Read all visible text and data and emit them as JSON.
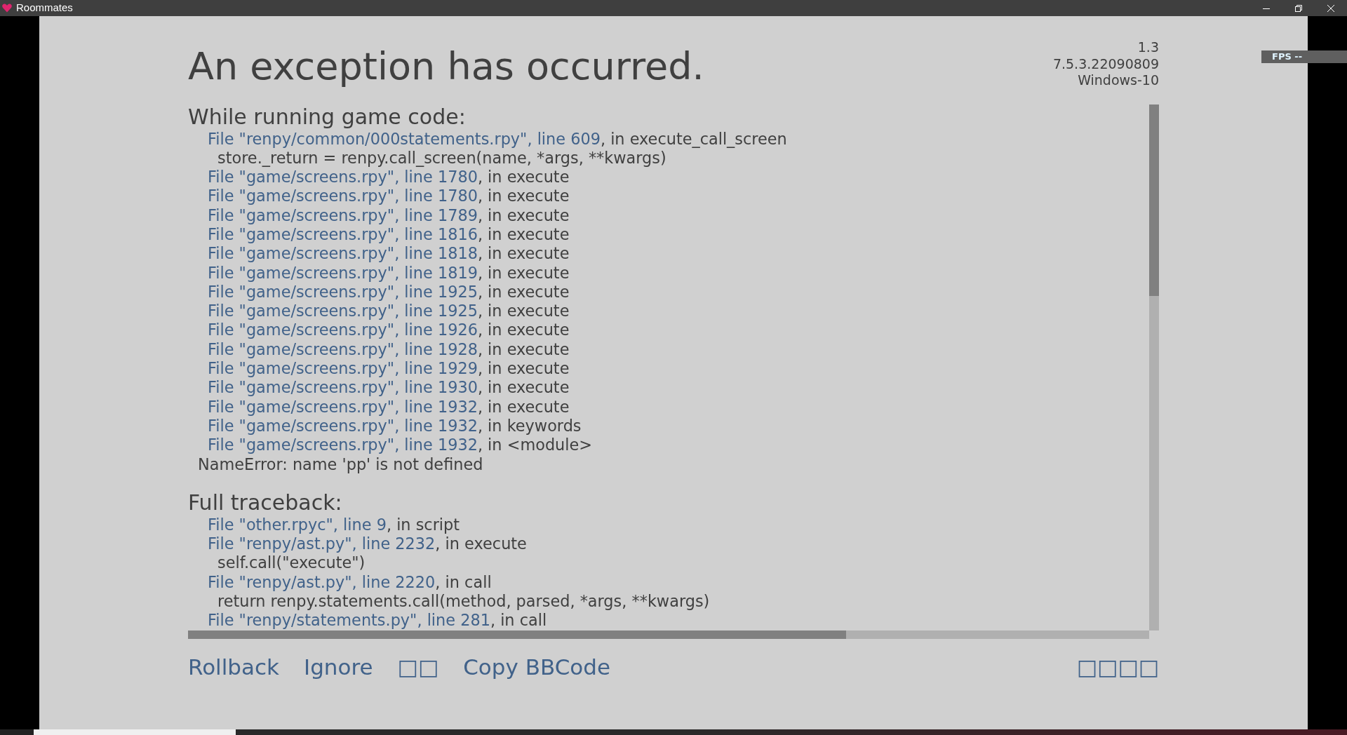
{
  "window": {
    "title": "Roommates"
  },
  "header": {
    "title": "An exception has occurred.",
    "version_info": [
      "1.3",
      "7.5.3.22090809",
      "Windows-10"
    ]
  },
  "fps_overlay": "FPS --",
  "sections": [
    {
      "heading": "While running game code:",
      "lines": [
        {
          "kind": "frame",
          "link": "File \"renpy/common/000statements.rpy\", line 609",
          "rest": ", in execute_call_screen"
        },
        {
          "kind": "code",
          "text": "store._return = renpy.call_screen(name, *args, **kwargs)"
        },
        {
          "kind": "frame",
          "link": "File \"game/screens.rpy\", line 1780",
          "rest": ", in execute"
        },
        {
          "kind": "frame",
          "link": "File \"game/screens.rpy\", line 1780",
          "rest": ", in execute"
        },
        {
          "kind": "frame",
          "link": "File \"game/screens.rpy\", line 1789",
          "rest": ", in execute"
        },
        {
          "kind": "frame",
          "link": "File \"game/screens.rpy\", line 1816",
          "rest": ", in execute"
        },
        {
          "kind": "frame",
          "link": "File \"game/screens.rpy\", line 1818",
          "rest": ", in execute"
        },
        {
          "kind": "frame",
          "link": "File \"game/screens.rpy\", line 1819",
          "rest": ", in execute"
        },
        {
          "kind": "frame",
          "link": "File \"game/screens.rpy\", line 1925",
          "rest": ", in execute"
        },
        {
          "kind": "frame",
          "link": "File \"game/screens.rpy\", line 1925",
          "rest": ", in execute"
        },
        {
          "kind": "frame",
          "link": "File \"game/screens.rpy\", line 1926",
          "rest": ", in execute"
        },
        {
          "kind": "frame",
          "link": "File \"game/screens.rpy\", line 1928",
          "rest": ", in execute"
        },
        {
          "kind": "frame",
          "link": "File \"game/screens.rpy\", line 1929",
          "rest": ", in execute"
        },
        {
          "kind": "frame",
          "link": "File \"game/screens.rpy\", line 1930",
          "rest": ", in execute"
        },
        {
          "kind": "frame",
          "link": "File \"game/screens.rpy\", line 1932",
          "rest": ", in execute"
        },
        {
          "kind": "frame",
          "link": "File \"game/screens.rpy\", line 1932",
          "rest": ", in keywords"
        },
        {
          "kind": "frame",
          "link": "File \"game/screens.rpy\", line 1932",
          "rest": ", in <module>"
        },
        {
          "kind": "error",
          "text": "NameError: name 'pp' is not defined"
        }
      ]
    },
    {
      "heading": "Full traceback:",
      "lines": [
        {
          "kind": "frame",
          "link": "File \"other.rpyc\", line 9",
          "rest": ", in script"
        },
        {
          "kind": "frame",
          "link": "File \"renpy/ast.py\", line 2232",
          "rest": ", in execute"
        },
        {
          "kind": "code",
          "text": "self.call(\"execute\")"
        },
        {
          "kind": "frame",
          "link": "File \"renpy/ast.py\", line 2220",
          "rest": ", in call"
        },
        {
          "kind": "code",
          "text": "return renpy.statements.call(method, parsed, *args, **kwargs)"
        },
        {
          "kind": "frame",
          "link": "File \"renpy/statements.py\", line 281",
          "rest": ", in call"
        }
      ]
    }
  ],
  "actions": [
    "Rollback",
    "Ignore",
    "□□",
    "Copy BBCode"
  ],
  "right_action": "□□□□"
}
